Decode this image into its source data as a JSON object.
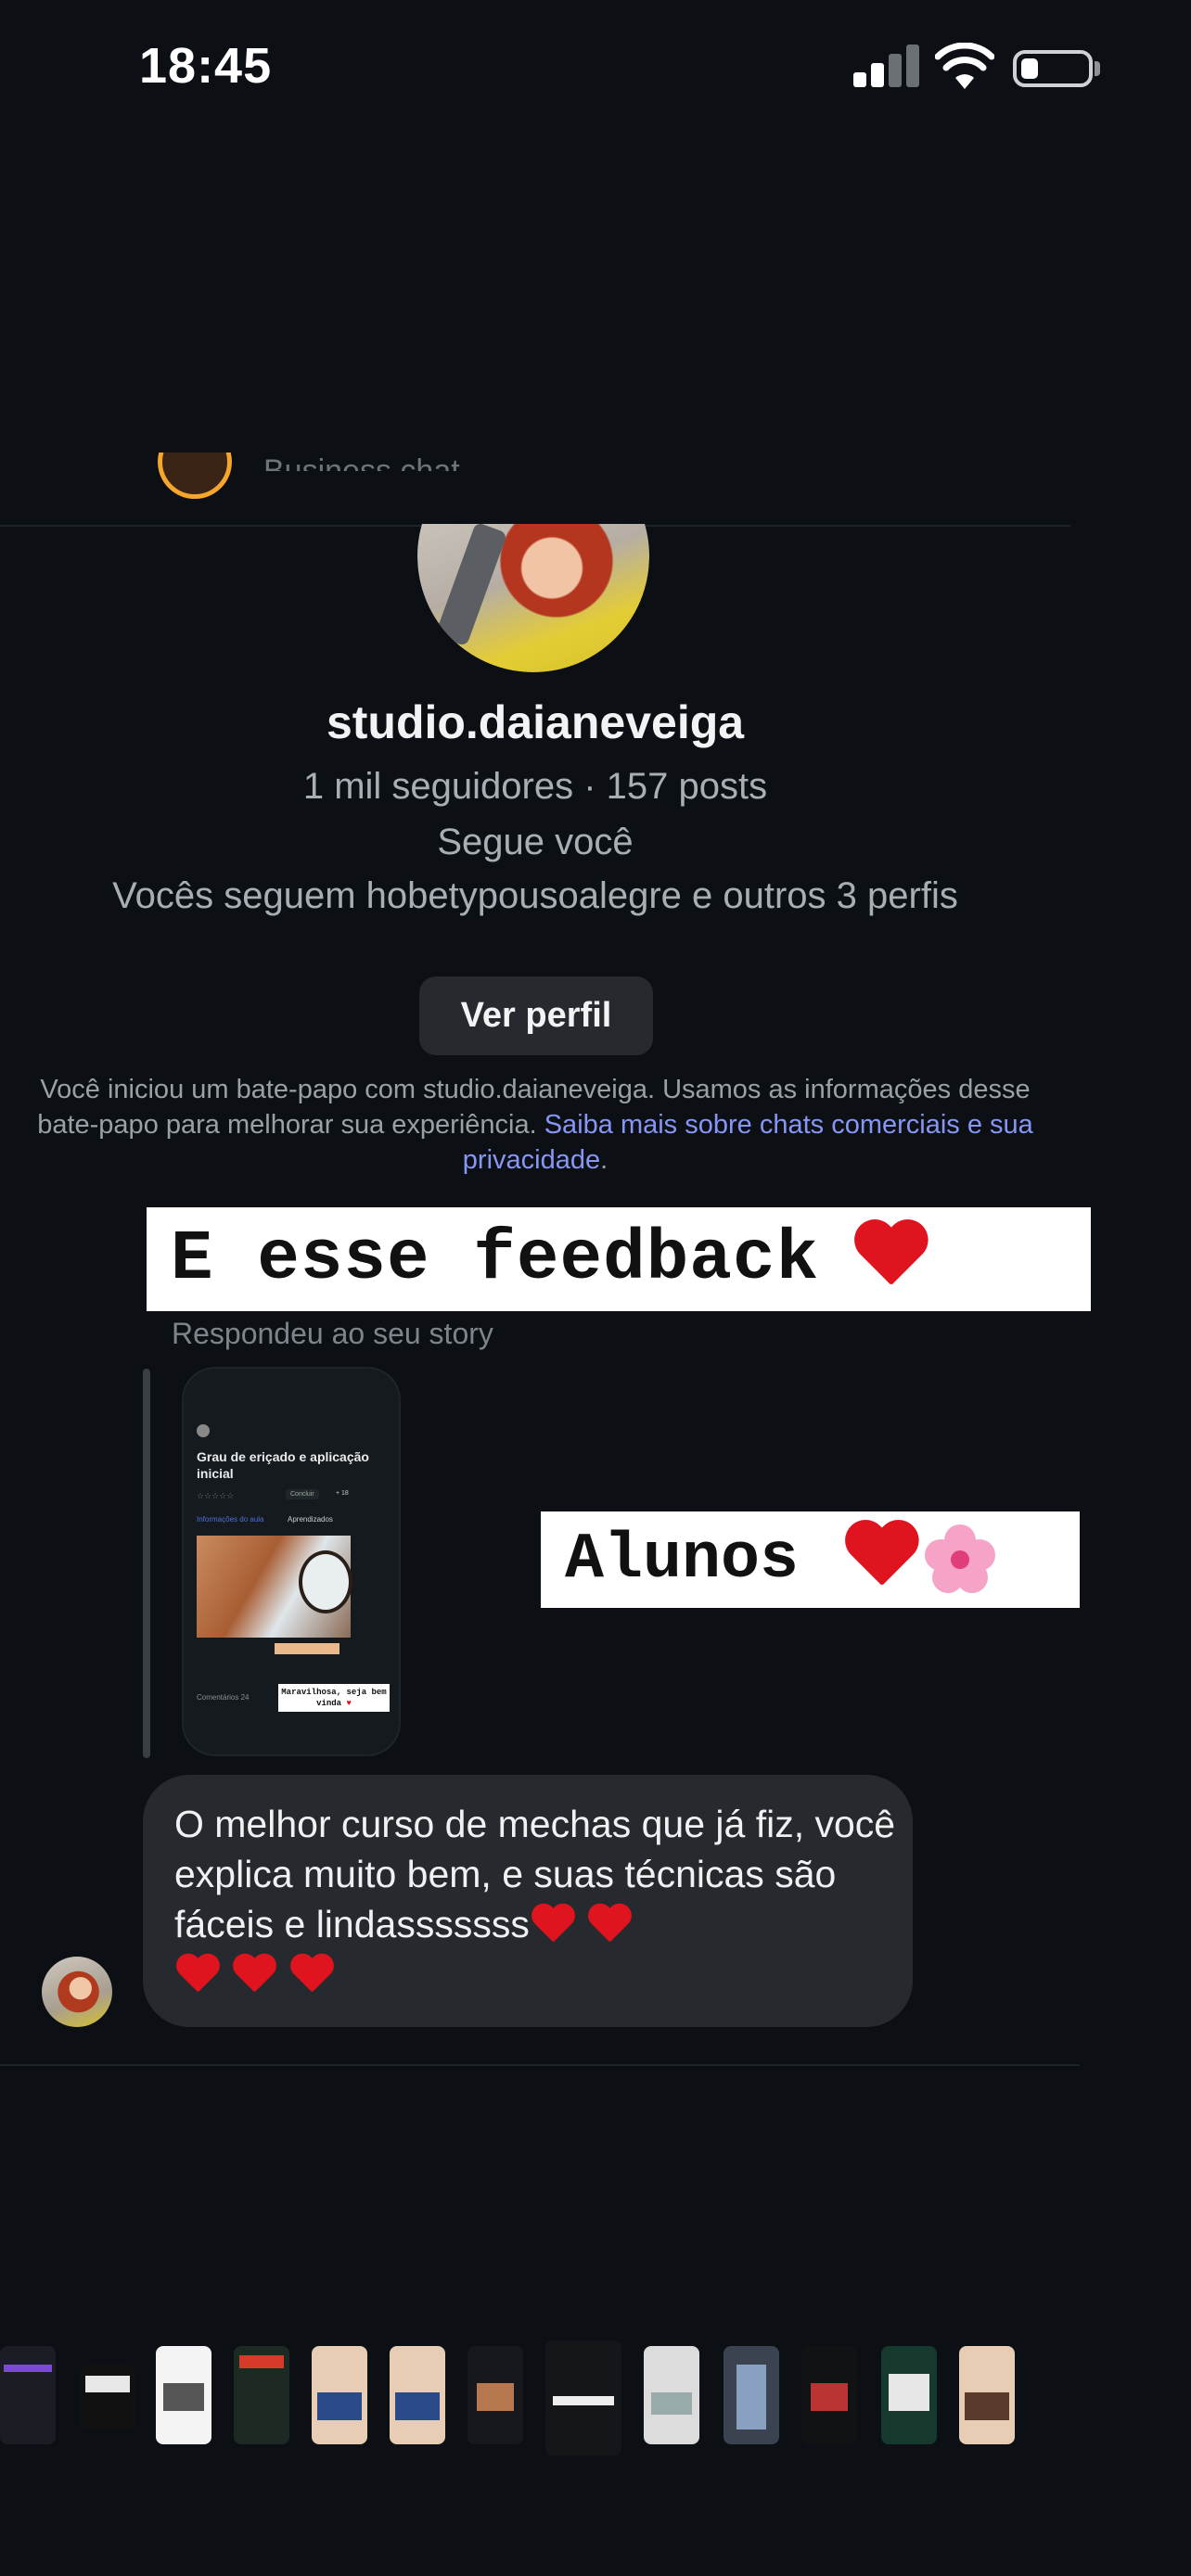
{
  "status_bar": {
    "time": "18:45"
  },
  "header": {
    "subtitle": "Business chat"
  },
  "profile": {
    "username": "studio.daianeveiga",
    "stats": "1 mil seguidores · 157 posts",
    "follows_you": "Segue você",
    "mutuals": "Vocês seguem hobetypousoalegre e outros 3 perfis",
    "view_profile_label": "Ver perfil"
  },
  "info": {
    "text": "Você iniciou um bate-papo com studio.daianeveiga. Usamos as informações desse bate-papo para melhorar sua experiência.",
    "link": "Saiba mais sobre chats comerciais e sua privacidade",
    "end": "."
  },
  "messages": {
    "feedback_sticker": "E esse feedback",
    "replied_label": "Respondeu ao seu story",
    "story": {
      "title": "Grau de eriçado e aplicação inicial",
      "stars": "☆☆☆☆☆",
      "button": "Concluir",
      "rating": "+ 18",
      "link": "Informações do aula",
      "learn": "Aprendizados",
      "comments": "Comentários 24",
      "sticker": "Maravilhosa, seja bem vinda"
    },
    "alunos_sticker": "Alunos",
    "bubble_text": "O melhor curso de mechas que já fiz, você explica muito bem, e suas técnicas são fáceis e lindasssssss"
  },
  "colors": {
    "background": "#0c1014",
    "bubble": "#262a2e",
    "link": "#8796f4",
    "heart": "#e0141e"
  }
}
